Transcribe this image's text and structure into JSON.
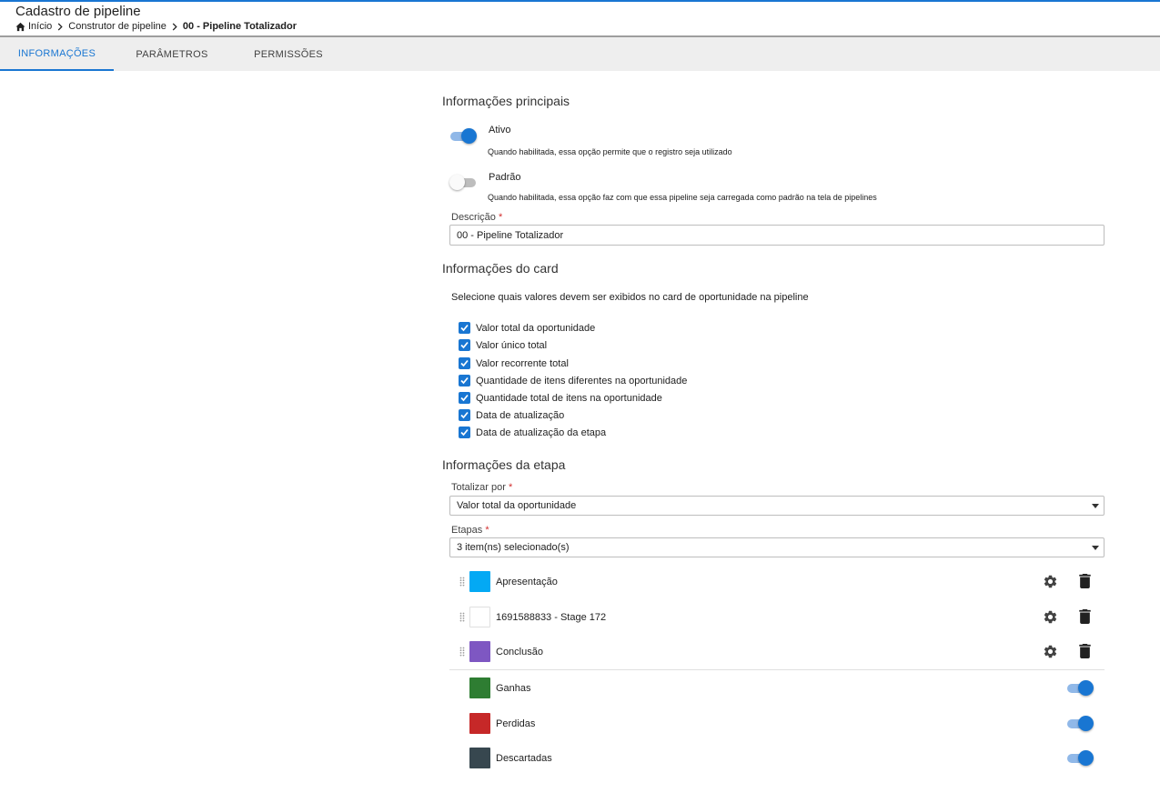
{
  "header": {
    "title": "Cadastro de pipeline",
    "breadcrumb": [
      "Início",
      "Construtor de pipeline",
      "00 - Pipeline Totalizador"
    ]
  },
  "tabs": [
    {
      "label": "INFORMAÇÕES",
      "active": true
    },
    {
      "label": "PARÂMETROS",
      "active": false
    },
    {
      "label": "PERMISSÕES",
      "active": false
    }
  ],
  "main_info": {
    "title": "Informações principais",
    "ativo": {
      "label": "Ativo",
      "help": "Quando habilitada, essa opção permite que o registro seja utilizado",
      "on": true
    },
    "padrao": {
      "label": "Padrão",
      "help": "Quando habilitada, essa opção faz com que essa pipeline seja carregada como padrão na tela de pipelines",
      "on": false
    },
    "descricao_label": "Descrição",
    "descricao_value": "00 - Pipeline Totalizador",
    "required_mark": "*"
  },
  "card_info": {
    "title": "Informações do card",
    "description": "Selecione quais valores devem ser exibidos no card de oportunidade na pipeline",
    "options": [
      {
        "label": "Valor total da oportunidade",
        "checked": true
      },
      {
        "label": "Valor único total",
        "checked": true
      },
      {
        "label": "Valor recorrente total",
        "checked": true
      },
      {
        "label": "Quantidade de itens diferentes na oportunidade",
        "checked": true
      },
      {
        "label": "Quantidade total de itens na oportunidade",
        "checked": true
      },
      {
        "label": "Data de atualização",
        "checked": true
      },
      {
        "label": "Data de atualização da etapa",
        "checked": true
      }
    ]
  },
  "stage_info": {
    "title": "Informações da etapa",
    "totalizar_label": "Totalizar por",
    "totalizar_value": "Valor total da oportunidade",
    "etapas_label": "Etapas",
    "etapas_value": "3 item(ns) selecionado(s)",
    "stages": [
      {
        "name": "Apresentação",
        "color": "#03a9f4"
      },
      {
        "name": "1691588833 - Stage 172",
        "color": "#ffffff"
      },
      {
        "name": "Conclusão",
        "color": "#7e57c2"
      }
    ],
    "final_stages": [
      {
        "name": "Ganhas",
        "color": "#2e7d32",
        "on": true
      },
      {
        "name": "Perdidas",
        "color": "#c62828",
        "on": true
      },
      {
        "name": "Descartadas",
        "color": "#37474f",
        "on": true
      }
    ]
  },
  "colors": {
    "accent": "#1976d2"
  }
}
